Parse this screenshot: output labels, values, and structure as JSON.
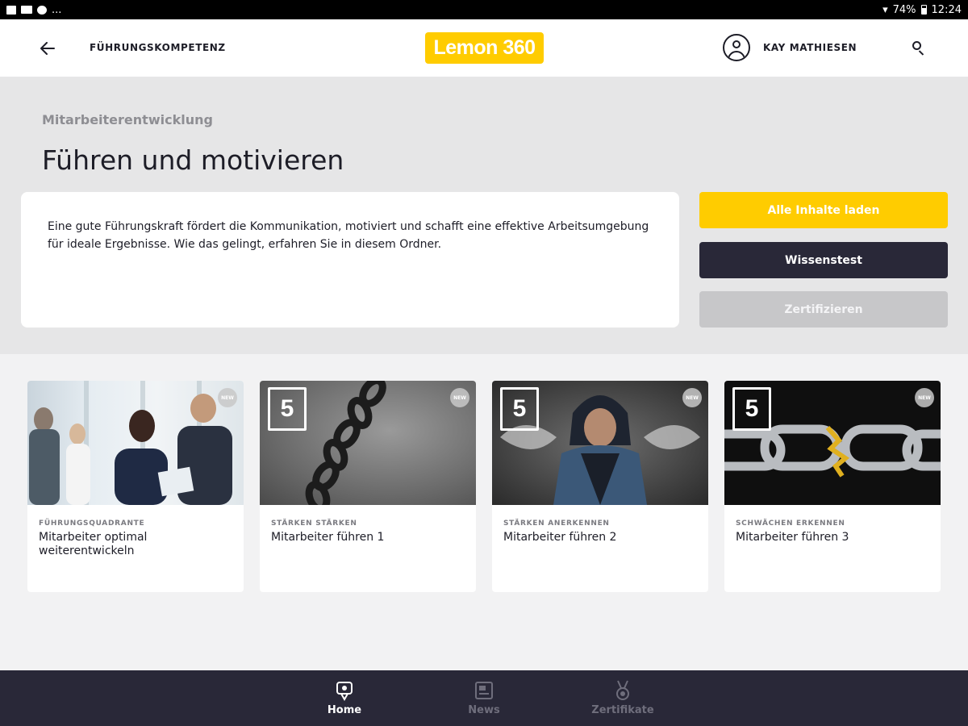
{
  "statusbar": {
    "left_text": "...",
    "battery": "74%",
    "time": "12:24"
  },
  "appbar": {
    "breadcrumb": "FÜHRUNGSKOMPETENZ",
    "logo": "Lemon 360",
    "username": "KAY MATHIESEN"
  },
  "hero": {
    "category": "Mitarbeiterentwicklung",
    "title": "Führen und motivieren",
    "description": "Eine gute Führungskraft fördert die Kommunikation, motiviert und schafft eine effektive Arbeitsumgebung für ideale Ergebnisse. Wie das gelingt, erfahren Sie in diesem Ordner.",
    "buttons": {
      "load_all": "Alle Inhalte laden",
      "knowledge_test": "Wissenstest",
      "certify": "Zertifizieren"
    }
  },
  "cards": [
    {
      "kicker": "FÜHRUNGSQUADRANTE",
      "title": "Mitarbeiter optimal weiterentwickeln",
      "badge": "NEW"
    },
    {
      "kicker": "STÄRKEN STÄRKEN",
      "title": "Mitarbeiter führen 1",
      "badge": "NEW",
      "h5": "5"
    },
    {
      "kicker": "STÄRKEN ANERKENNEN",
      "title": "Mitarbeiter führen 2",
      "badge": "NEW",
      "h5": "5"
    },
    {
      "kicker": "SCHWÄCHEN ERKENNEN",
      "title": "Mitarbeiter führen 3",
      "badge": "NEW",
      "h5": "5"
    }
  ],
  "bottomnav": {
    "home": "Home",
    "news": "News",
    "certificates": "Zertifikate"
  },
  "colors": {
    "brand_yellow": "#ffcc00",
    "dark": "#292838",
    "disabled": "#c7c7c9"
  }
}
